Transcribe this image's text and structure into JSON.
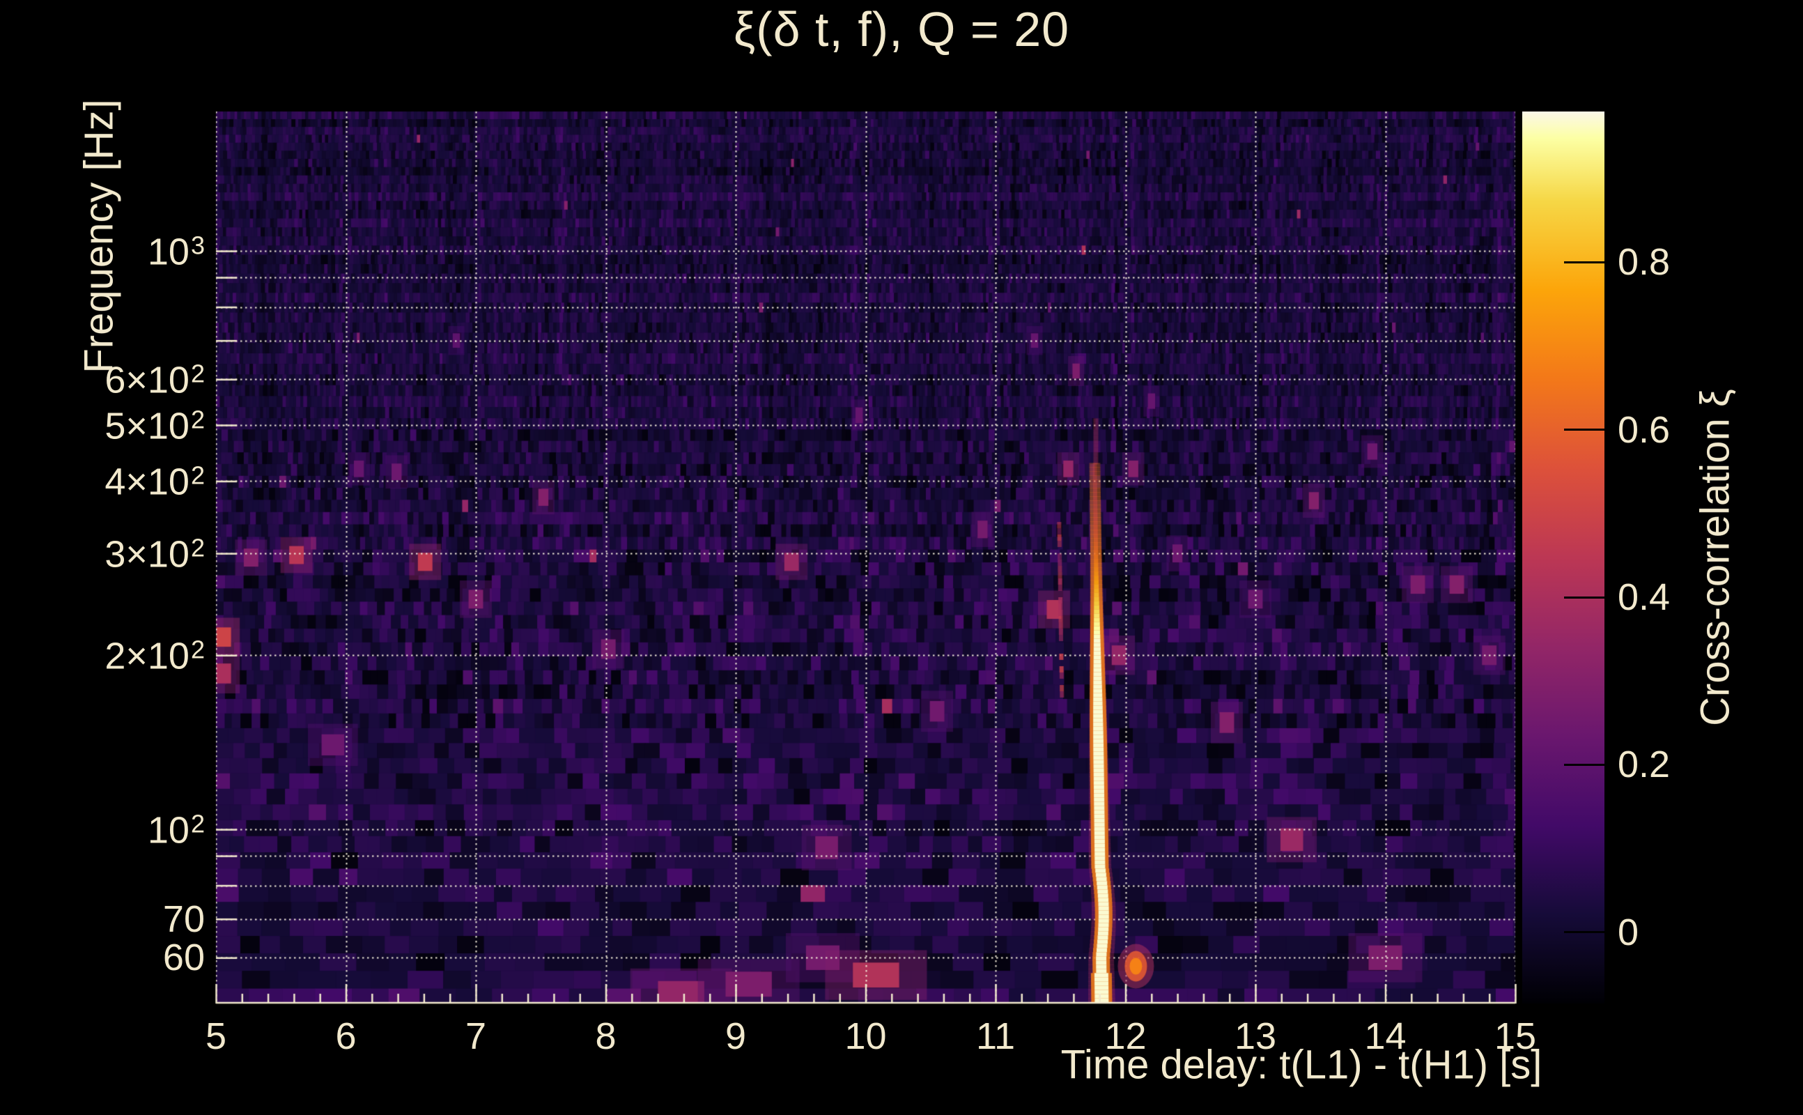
{
  "title": "ξ(δ t, f), Q = 20",
  "colors": {
    "background": "#000000",
    "text_cream": "#f2e9cd",
    "gridline": "rgba(247,240,220,0.95)",
    "colorbar_tick": "#000000"
  },
  "chart_data": {
    "type": "heatmap",
    "title": "ξ(δ t, f), Q = 20",
    "xlabel": "Time delay: t(L1) - t(H1) [s]",
    "ylabel": "Frequency [Hz]",
    "colorbar_label": "Cross-correlation ξ",
    "xlim": [
      5,
      15
    ],
    "ylim_hz": [
      50,
      1742
    ],
    "xscale": "linear",
    "yscale": "log",
    "grid": true,
    "x_ticks": [
      5,
      6,
      7,
      8,
      9,
      10,
      11,
      12,
      13,
      14,
      15
    ],
    "x_minor_step": 0.2,
    "y_ticks": [
      {
        "f": 1000,
        "base": "10",
        "exp": "3"
      },
      {
        "f": 600,
        "base": "6×10",
        "exp": "2"
      },
      {
        "f": 500,
        "base": "5×10",
        "exp": "2"
      },
      {
        "f": 400,
        "base": "4×10",
        "exp": "2"
      },
      {
        "f": 300,
        "base": "3×10",
        "exp": "2"
      },
      {
        "f": 200,
        "base": "2×10",
        "exp": "2"
      },
      {
        "f": 100,
        "base": "10",
        "exp": "2"
      },
      {
        "f": 70,
        "base": "70"
      },
      {
        "f": 60,
        "base": "60"
      }
    ],
    "y_minor_gridlines_hz": [
      900,
      800,
      700,
      90,
      80
    ],
    "colorbar_ticks": [
      {
        "v": 0.8,
        "label": "0.8"
      },
      {
        "v": 0.6,
        "label": "0.6"
      },
      {
        "v": 0.4,
        "label": "0.4"
      },
      {
        "v": 0.2,
        "label": "0.2"
      },
      {
        "v": 0,
        "label": "0"
      }
    ],
    "colorbar_range": [
      -0.085,
      0.98
    ],
    "colormap": "inferno",
    "colormap_stops": [
      [
        0.0,
        "#000004"
      ],
      [
        0.1,
        "#160b39"
      ],
      [
        0.2,
        "#420a68"
      ],
      [
        0.3,
        "#6a176e"
      ],
      [
        0.4,
        "#932667"
      ],
      [
        0.5,
        "#bc3754"
      ],
      [
        0.6,
        "#dd513a"
      ],
      [
        0.7,
        "#f37819"
      ],
      [
        0.8,
        "#fca50a"
      ],
      [
        0.9,
        "#f6d746"
      ],
      [
        0.97,
        "#fcffa4"
      ],
      [
        1.0,
        "#fbf7e8"
      ]
    ],
    "background_xi": {
      "mean": 0.02,
      "std": 0.04
    },
    "event": {
      "t": 11.78,
      "f_min_hz": 50,
      "f_max_hz": 430,
      "peak_xi": 0.98,
      "description": "bright vertical cross-correlation streak, white-hot below ~300 Hz"
    },
    "secondary_streak": {
      "t": 11.49,
      "f_min_hz": 170,
      "f_max_hz": 340,
      "xi": 0.45
    },
    "blob": {
      "t": 12.08,
      "f_hz": 58,
      "xi": 0.55
    },
    "specks": [
      [
        5.06,
        215,
        0.5
      ],
      [
        5.06,
        186,
        0.4
      ],
      [
        5.27,
        295,
        0.3
      ],
      [
        5.62,
        298,
        0.44
      ],
      [
        5.9,
        140,
        0.24
      ],
      [
        6.1,
        420,
        0.22
      ],
      [
        6.39,
        415,
        0.24
      ],
      [
        6.61,
        290,
        0.46
      ],
      [
        7.0,
        250,
        0.28
      ],
      [
        7.52,
        375,
        0.3
      ],
      [
        8.02,
        205,
        0.26
      ],
      [
        8.58,
        52,
        0.34
      ],
      [
        9.1,
        54,
        0.28
      ],
      [
        9.43,
        290,
        0.36
      ],
      [
        9.67,
        60,
        0.26
      ],
      [
        9.7,
        93,
        0.27
      ],
      [
        10.08,
        56,
        0.42
      ],
      [
        10.55,
        160,
        0.25
      ],
      [
        10.9,
        330,
        0.26
      ],
      [
        11.45,
        240,
        0.42
      ],
      [
        11.56,
        420,
        0.34
      ],
      [
        11.62,
        620,
        0.28
      ],
      [
        11.95,
        200,
        0.34
      ],
      [
        12.06,
        420,
        0.3
      ],
      [
        12.4,
        300,
        0.24
      ],
      [
        12.78,
        153,
        0.3
      ],
      [
        13.0,
        250,
        0.24
      ],
      [
        13.28,
        96,
        0.36
      ],
      [
        13.45,
        370,
        0.3
      ],
      [
        13.9,
        450,
        0.24
      ],
      [
        14.0,
        60,
        0.28
      ],
      [
        14.25,
        265,
        0.28
      ],
      [
        14.55,
        265,
        0.3
      ],
      [
        14.8,
        200,
        0.26
      ],
      [
        6.85,
        700,
        0.2
      ],
      [
        9.95,
        520,
        0.22
      ],
      [
        11.3,
        700,
        0.22
      ],
      [
        12.2,
        550,
        0.22
      ]
    ]
  }
}
